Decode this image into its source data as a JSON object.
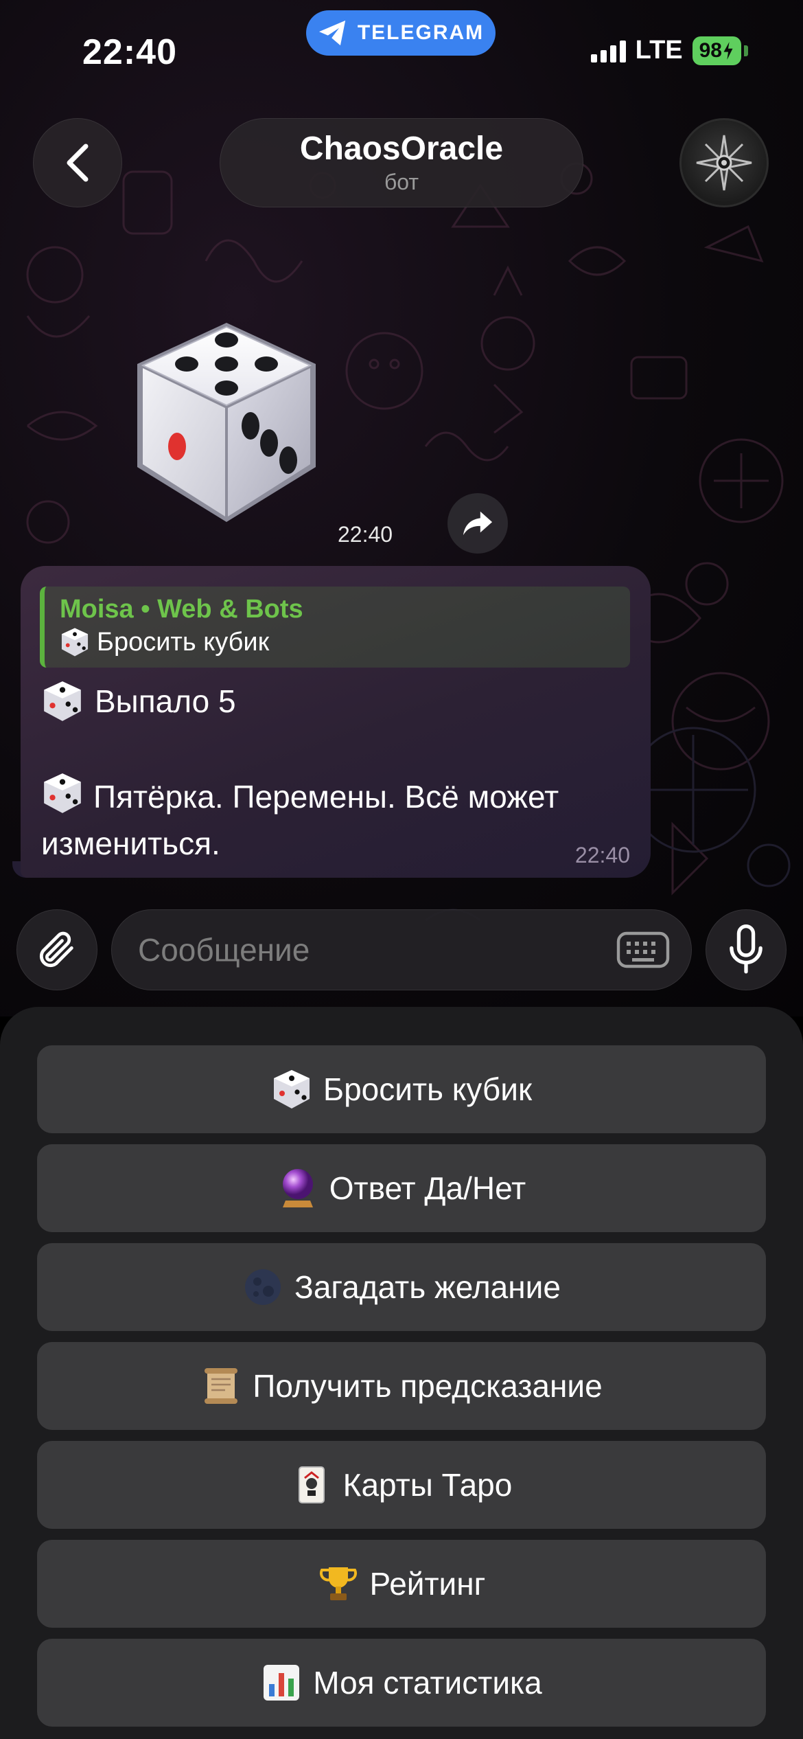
{
  "status_bar": {
    "time": "22:40",
    "app_label": "TELEGRAM",
    "network": "LTE",
    "battery": "98"
  },
  "header": {
    "title": "ChaosOracle",
    "subtitle": "бот"
  },
  "sticker": {
    "time": "22:40"
  },
  "message": {
    "reply_author": "Moisa • Web & Bots",
    "reply_text": "Бросить кубик",
    "line1": "Выпало 5",
    "line2": "Пятёрка. Перемены. Всё может измениться.",
    "time": "22:40"
  },
  "input": {
    "placeholder": "Сообщение"
  },
  "keyboard": {
    "buttons": [
      {
        "emoji": "dice-icon",
        "label": "Бросить кубик"
      },
      {
        "emoji": "crystal-ball-icon",
        "label": "Ответ Да/Нет"
      },
      {
        "emoji": "moon-icon",
        "label": "Загадать желание"
      },
      {
        "emoji": "scroll-icon",
        "label": "Получить предсказание"
      },
      {
        "emoji": "joker-card-icon",
        "label": "Карты Таро"
      },
      {
        "emoji": "trophy-icon",
        "label": "Рейтинг"
      },
      {
        "emoji": "bar-chart-icon",
        "label": "Моя статистика"
      }
    ]
  },
  "colors": {
    "telegram_blue": "#3a82f0",
    "reply_accent": "#5cb33e",
    "battery_green": "#5fcf5e",
    "keyboard_button": "#3a3a3c"
  }
}
